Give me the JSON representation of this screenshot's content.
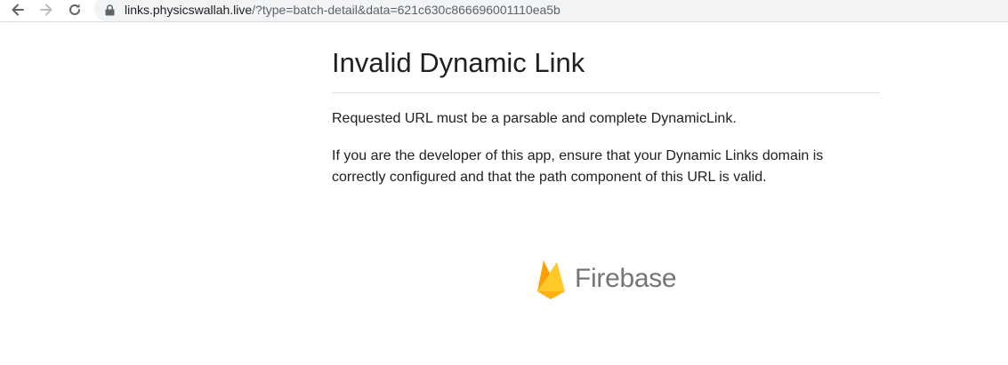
{
  "browser": {
    "url_host": "links.physicswallah.live",
    "url_path": "/?type=batch-detail&data=621c630c866696001110ea5b",
    "icons": {
      "back": "back-arrow-icon",
      "forward": "forward-arrow-icon",
      "reload": "reload-icon",
      "lock": "lock-icon"
    }
  },
  "page": {
    "title": "Invalid Dynamic Link",
    "message": "Requested URL must be a parsable and complete DynamicLink.",
    "developer_note_line1": "If you are the developer of this app, ensure that your Dynamic Links domain is",
    "developer_note_line2": "correctly configured and that the path component of this URL is valid."
  },
  "brand": {
    "name": "Firebase",
    "colors": {
      "flame_dark": "#FFA000",
      "flame_mid": "#F57C00",
      "flame_light": "#FFCA28",
      "text": "#757575"
    }
  }
}
